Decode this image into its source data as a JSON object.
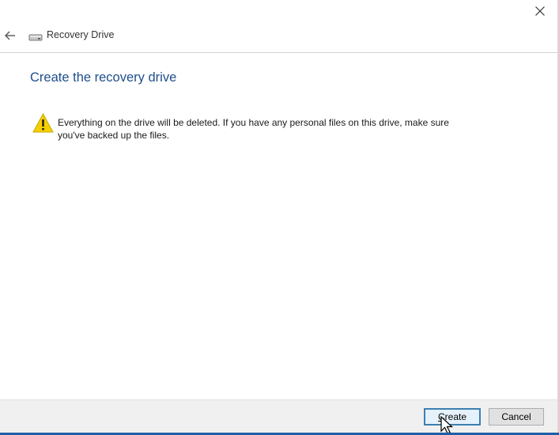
{
  "window": {
    "close_icon": "close-icon"
  },
  "header": {
    "back_icon": "back-arrow-icon",
    "drive_icon": "drive-icon",
    "title": "Recovery Drive"
  },
  "main": {
    "heading": "Create the recovery drive",
    "warning_icon": "warning-icon",
    "warning_text": "Everything on the drive will be deleted. If you have any personal files on this drive, make sure you've backed up the files."
  },
  "footer": {
    "create_label": "Create",
    "cancel_label": "Cancel"
  },
  "colors": {
    "heading": "#1e4e8c",
    "warning_yellow": "#f5d000",
    "focus_border": "#3c7fb1"
  }
}
